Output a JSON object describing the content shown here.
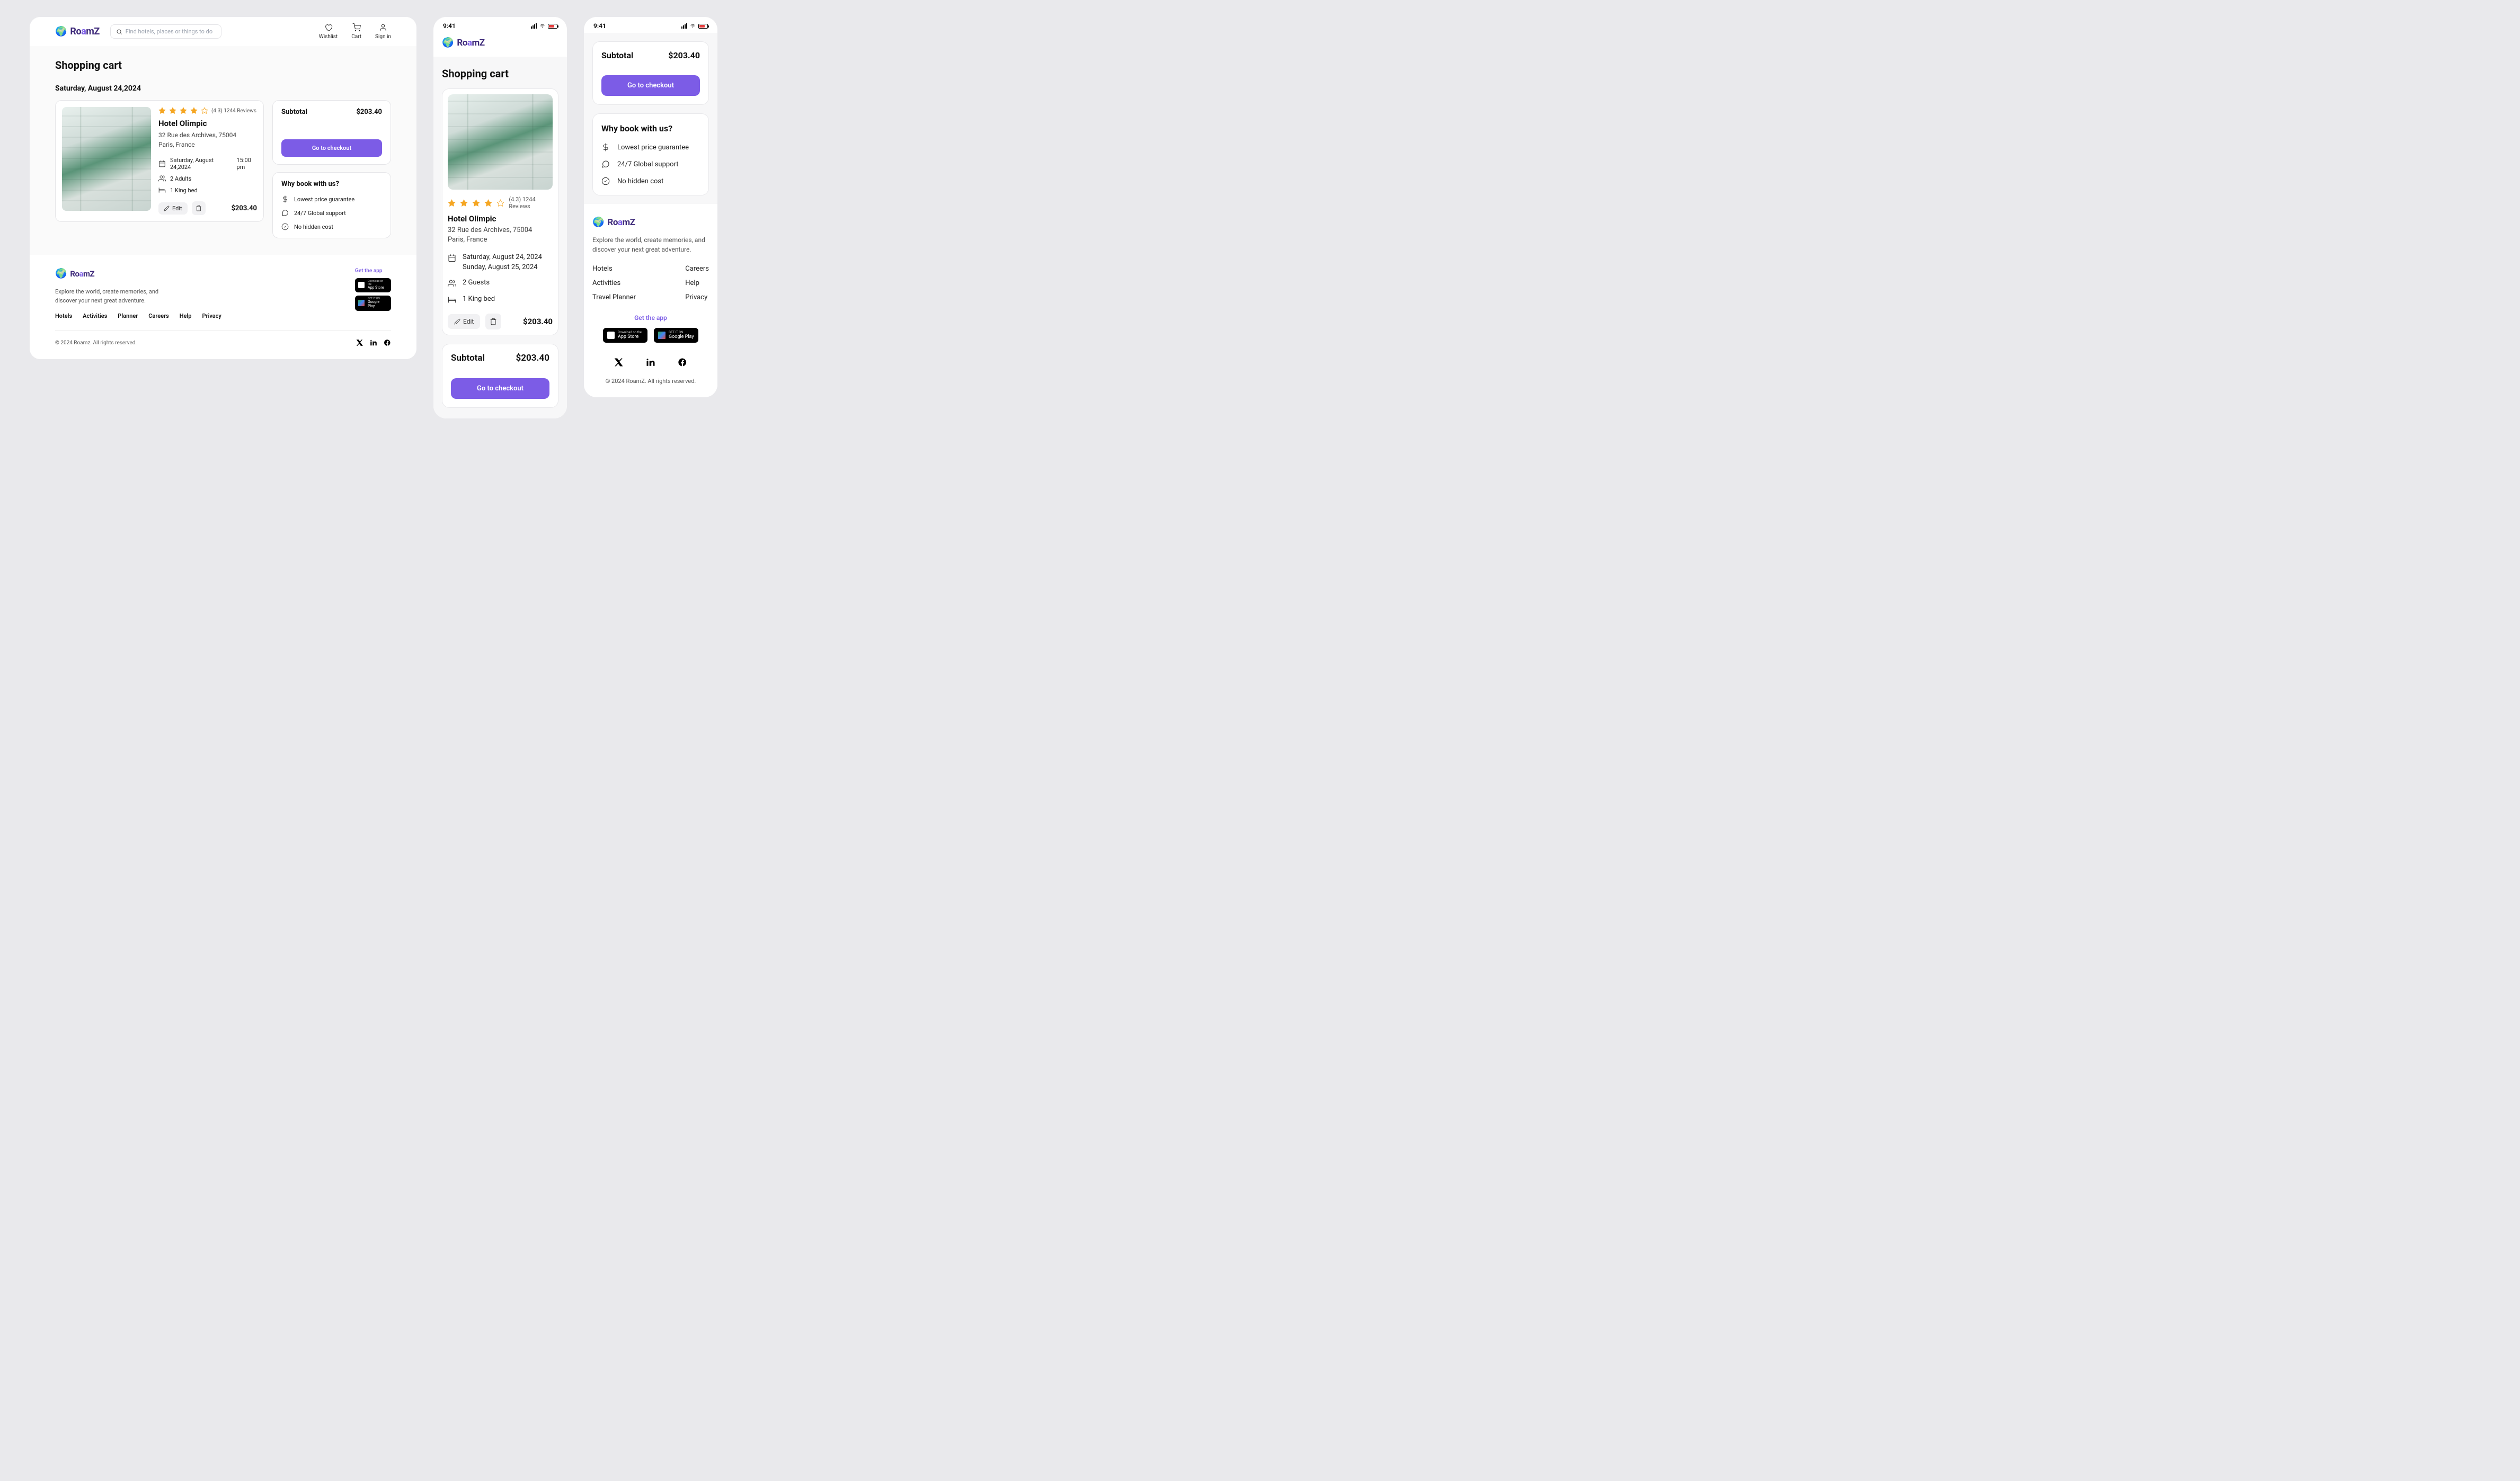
{
  "brand": "RoamZ",
  "search_placeholder": "Find hotels, places or things to do",
  "nav": {
    "wishlist": "Wishlist",
    "cart": "Cart",
    "signin": "Sign in"
  },
  "page_title": "Shopping cart",
  "date_heading": "Saturday, August 24,2024",
  "hotel": {
    "name": "Hotel Olimpic",
    "address_line1": "32 Rue des Archives, 75004",
    "address_line2": "Paris, France",
    "rating_value": "(4.3)",
    "reviews": "1244 Reviews",
    "checkin_date": "Saturday, August 24,2024",
    "checkin_time": "15:00 pm",
    "guests": "2 Adults",
    "bed": "1 King bed",
    "price": "$203.40"
  },
  "hotel_mobile": {
    "checkin": "Saturday, August 24, 2024",
    "checkout": "Sunday, August 25, 2024",
    "guests": "2 Guests",
    "bed": "1 King bed",
    "address_line1": "32 Rue des Archives, 75004",
    "address_line2": "Paris, France",
    "rating_value": "(4.3)",
    "reviews": "1244 Reviews"
  },
  "actions": {
    "edit": "Edit"
  },
  "subtotal": {
    "label": "Subtotal",
    "value": "$203.40"
  },
  "checkout_btn": "Go to checkout",
  "why": {
    "title": "Why book with us?",
    "items": [
      "Lowest price guarantee",
      "24/7 Global support",
      "No hidden cost"
    ]
  },
  "footer": {
    "tagline": "Explore the world, create memories, and discover your next great adventure.",
    "links": [
      "Hotels",
      "Activities",
      "Planner",
      "Careers",
      "Help",
      "Privacy"
    ],
    "links_m2_left": [
      "Hotels",
      "Activities",
      "Travel Planner"
    ],
    "links_m2_right": [
      "Careers",
      "Help",
      "Privacy"
    ],
    "get_app": "Get the app",
    "app_store_small": "Download on the",
    "app_store": "App Store",
    "gplay_small": "GET IT ON",
    "gplay": "Google Play",
    "copyright_desktop": "© 2024 Roamz. All rights reserved.",
    "copyright_mobile": "© 2024 RoamZ. All rights reserved."
  },
  "status_time": "9:41"
}
